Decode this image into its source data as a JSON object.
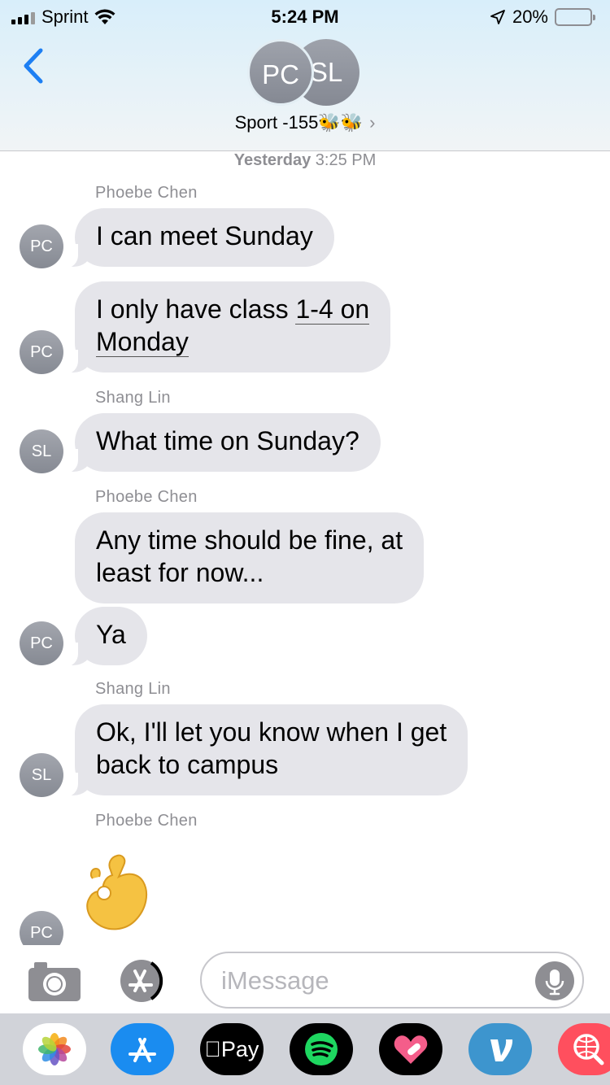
{
  "status_bar": {
    "carrier": "Sprint",
    "time": "5:24 PM",
    "battery_percent": "20%",
    "battery_level": 0.2,
    "battery_color": "#ff3b30"
  },
  "header": {
    "avatars": [
      "PC",
      "SL"
    ],
    "group_name": "Sport -155🐝🐝",
    "chevron": "›",
    "background_color": "#dcebf5"
  },
  "thread": {
    "timestamp_day": "Yesterday",
    "timestamp_time": "3:25 PM",
    "bubble_color": "#e5e5ea",
    "messages": [
      {
        "sender": "Phoebe Chen",
        "text": "I can meet Sunday",
        "avatar": "PC"
      },
      {
        "text_prefix": "I only have class ",
        "text_link": "1-4 on",
        "text_line2": "Monday",
        "avatar": "PC"
      },
      {
        "sender": "Shang Lin",
        "text": "What time on Sunday?",
        "avatar": "SL"
      },
      {
        "sender": "Phoebe Chen",
        "line1": "Any time should be fine, at",
        "line2": "least for now..."
      },
      {
        "text": "Ya",
        "avatar": "PC"
      },
      {
        "sender": "Shang Lin",
        "line1": "Ok, I'll let you know when I get",
        "line2": "back to campus",
        "avatar": "SL"
      },
      {
        "sender": "Phoebe Chen",
        "emoji": "ok-hand",
        "avatar": "PC"
      }
    ]
  },
  "input_bar": {
    "placeholder": "iMessage",
    "camera_icon": "camera-icon",
    "apps_icon": "app-store-icon",
    "mic_icon": "microphone-icon"
  },
  "app_drawer": {
    "apps": [
      {
        "name": "photos-app-icon",
        "color": "#ffffff"
      },
      {
        "name": "app-store-icon",
        "color": "#1a8cf0"
      },
      {
        "name": "apple-pay-icon",
        "label": "Pay",
        "color": "#000000"
      },
      {
        "name": "spotify-icon",
        "color": "#000000"
      },
      {
        "name": "heart-app-icon",
        "color": "#000000"
      },
      {
        "name": "venmo-icon",
        "color": "#3d95ce"
      },
      {
        "name": "search-web-icon",
        "color": "#ff4f5e"
      }
    ]
  }
}
